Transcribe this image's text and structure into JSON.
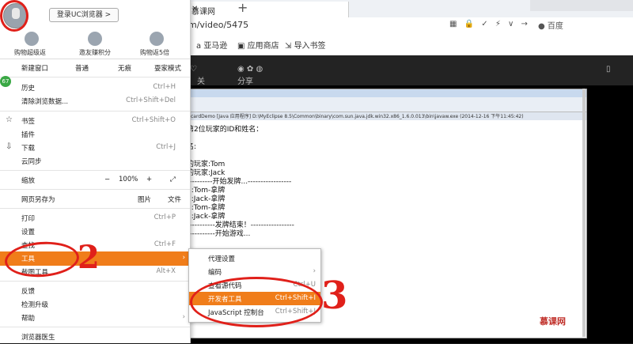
{
  "browser": {
    "tab_title": "慕课网",
    "url": "m/video/5475",
    "search_engine": "百度",
    "bookmarks": [
      "亚马逊",
      "应用商店",
      "导入书签"
    ],
    "dark_bar": [
      "关注",
      "分享"
    ]
  },
  "menu": {
    "login_button": "登录UC浏览器 >",
    "top_items": [
      {
        "label": "购物超级返",
        "icon": "shopping-bag-icon"
      },
      {
        "label": "邀友赚积分",
        "icon": "person-icon"
      },
      {
        "label": "购物返5倍",
        "icon": "cart-icon"
      }
    ],
    "new_window": {
      "label": "新建窗口",
      "options": [
        "普通",
        "无痕",
        "耍家模式"
      ]
    },
    "badge": "67",
    "items": [
      {
        "label": "历史",
        "shortcut": "Ctrl+H"
      },
      {
        "label": "清除浏览数据...",
        "shortcut": "Ctrl+Shift+Del"
      },
      {
        "label": "书签",
        "shortcut": "Ctrl+Shift+O"
      },
      {
        "label": "插件",
        "shortcut": ""
      },
      {
        "label": "下载",
        "shortcut": "Ctrl+J"
      },
      {
        "label": "云同步",
        "shortcut": ""
      }
    ],
    "zoom": {
      "label": "缩放",
      "minus": "−",
      "value": "100%",
      "plus": "+",
      "expand": "⤢"
    },
    "save_as": {
      "label": "网页另存为",
      "opt1": "图片",
      "opt2": "文件"
    },
    "print": {
      "label": "打印",
      "shortcut": "Ctrl+P"
    },
    "settings": {
      "label": "设置"
    },
    "find": {
      "label": "查找",
      "shortcut": "Ctrl+F"
    },
    "tools": {
      "label": "工具",
      "arrow": "›"
    },
    "screenshot": {
      "label": "截图工具",
      "shortcut": "Alt+X"
    },
    "feedback": {
      "label": "反馈"
    },
    "update": {
      "label": "检测升级"
    },
    "help": {
      "label": "帮助",
      "arrow": "›"
    },
    "doctor": {
      "label": "浏览器医生"
    }
  },
  "submenu": {
    "items": [
      {
        "label": "代理设置",
        "shortcut": ""
      },
      {
        "label": "编码",
        "shortcut": "›"
      },
      {
        "label": "查看源代码",
        "shortcut": "Ctrl+U"
      },
      {
        "label": "开发者工具",
        "shortcut": "Ctrl+Shift+I"
      },
      {
        "label": "JavaScript 控制台",
        "shortcut": "Ctrl+Shift+J"
      }
    ]
  },
  "console": {
    "header": "cardDemo [Java 应用程序] D:\\MyEclipse 8.5\\Common\\binary\\com.sun.java.jdk.win32.x86_1.6.0.013\\bin\\javaw.exe (2014-12-16 下午11:45:42)",
    "lines": [
      "第2位玩家的ID和姓名：",
      "",
      "名:",
      "",
      "的玩家:Tom",
      "的玩家:Jack",
      "----------开始发牌...-----------------",
      "2:Tom-拿牌",
      "2:Jack-拿牌",
      "2:Tom-拿牌",
      "2:Jack-拿牌",
      "-----------发牌结束！-----------------",
      "-----------开始游戏..."
    ]
  },
  "annotations": [
    "2",
    "3"
  ],
  "video_logo": "慕课网"
}
